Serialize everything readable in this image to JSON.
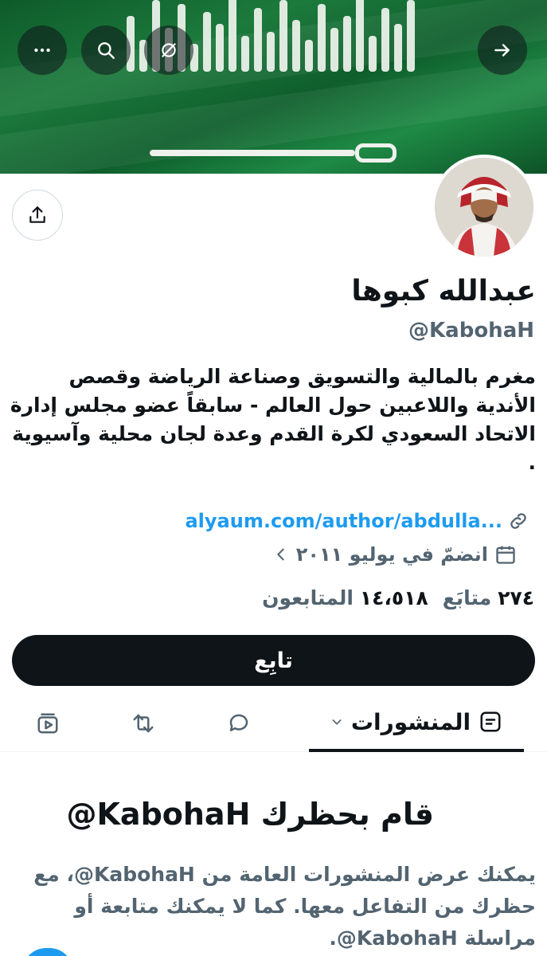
{
  "header": {
    "banner_theme": "saudi-flag",
    "buttons": [
      "more-icon",
      "search-icon",
      "mute-icon",
      "forward-arrow-icon"
    ]
  },
  "profile": {
    "name": "عبدالله كبوها",
    "handle": "@KabohaH",
    "bio": "مغرم بالمالية والتسويق وصناعة الرياضة وقصص الأندية واللاعبين حول العالم - سابقاً عضو مجلس إدارة الاتحاد السعودي لكرة القدم وعدة لجان محلية وآسيوية .",
    "link": "alyaum.com/author/abdulla...",
    "joined": "انضمّ في يوليو ٢٠١١",
    "following_count": "٢٧٤",
    "following_label": "متابَع",
    "followers_count": "١٤،٥١٨",
    "followers_label": "المتابعون"
  },
  "actions": {
    "follow_label": "تابِع"
  },
  "tabs": {
    "active_label": "المنشورات"
  },
  "blocked": {
    "title_ar": "قام بحظرك",
    "title_handle": "@KabohaH",
    "description": "يمكنك عرض المنشورات العامة من ‎@KabohaH‏، مع حظرك من التفاعل معها. كما لا يمكنك متابعة أو مراسلة ‎@KabohaH‏."
  },
  "colors": {
    "accent": "#1d9bf0",
    "text": "#0f1419",
    "muted": "#536471",
    "banner_green": "#1c7a3c"
  }
}
